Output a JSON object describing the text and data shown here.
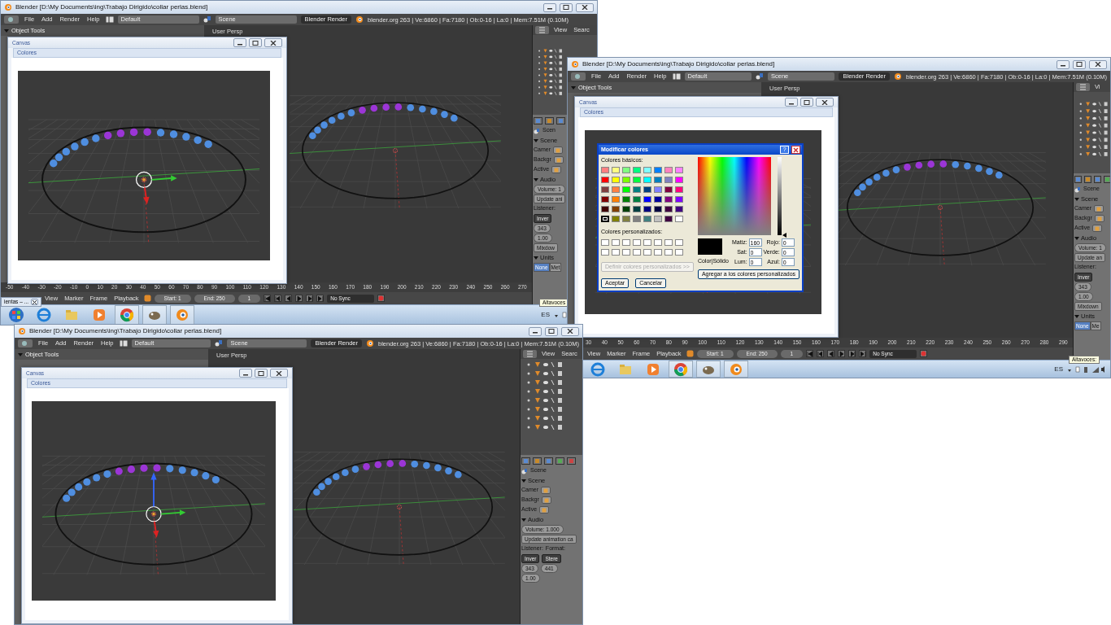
{
  "windows": [
    {
      "title": "Blender [D:\\My Documents\\ing\\Trabajo Dirigido\\collar perlas.blend]",
      "menus": [
        "File",
        "Add",
        "Render",
        "Help"
      ],
      "layout": "Default",
      "scene": "Scene",
      "engine": "Blender Render",
      "info": "blender.org 263 | Ve:6860 | Fa:7180 | Ob:0-16 | La:0 | Mem:7.51M (0.10M)",
      "tools_header": "Object Tools",
      "viewport_label": "User Persp",
      "outliner_menus": [
        "View",
        "Searc"
      ],
      "canvas": {
        "title": "Canvas",
        "menu": "Colores"
      },
      "properties": [
        {
          "cells": [
            {
              "kind": "tabs"
            }
          ]
        },
        {
          "cells": [
            {
              "kind": "breadcrumb",
              "text": "Scen"
            }
          ]
        },
        {
          "cells": [
            {
              "kind": "section",
              "text": "Scene"
            }
          ]
        },
        {
          "cells": [
            {
              "kind": "field",
              "text": "Camer"
            }
          ]
        },
        {
          "cells": [
            {
              "kind": "field",
              "text": "Backgr"
            }
          ]
        },
        {
          "cells": [
            {
              "kind": "field",
              "text": "Active"
            }
          ]
        },
        {
          "cells": [
            {
              "kind": "section",
              "text": "Audio"
            }
          ]
        },
        {
          "cells": [
            {
              "kind": "pill",
              "text": "Volume: 1"
            }
          ]
        },
        {
          "cells": [
            {
              "kind": "button",
              "text": "Update ani"
            }
          ]
        },
        {
          "cells": [
            {
              "kind": "label",
              "text": "Listener:"
            }
          ]
        },
        {
          "cells": [
            {
              "kind": "dropdown",
              "text": "Inver"
            }
          ]
        },
        {
          "cells": [
            {
              "kind": "pill",
              "text": "343"
            }
          ]
        },
        {
          "cells": [
            {
              "kind": "pill",
              "text": "1.00"
            }
          ]
        },
        {
          "cells": [
            {
              "kind": "button",
              "text": "Mixdow"
            }
          ]
        },
        {
          "cells": [
            {
              "kind": "section",
              "text": "Units"
            }
          ]
        },
        {
          "cells": [
            {
              "kind": "toggle",
              "text": "None",
              "selected": true
            },
            {
              "kind": "toggle",
              "text": "Met",
              "selected": false
            }
          ]
        }
      ],
      "timeline": {
        "ruler": [
          "-50",
          "-40",
          "-30",
          "-20",
          "-10",
          "0",
          "10",
          "20",
          "30",
          "40",
          "50",
          "60",
          "70",
          "80",
          "90",
          "100",
          "110",
          "120",
          "130",
          "140",
          "150",
          "160",
          "170",
          "180",
          "190",
          "200",
          "210",
          "220",
          "230",
          "240",
          "250",
          "260",
          "270"
        ],
        "menus": [
          "View",
          "Marker",
          "Frame",
          "Playback"
        ],
        "start": "Start: 1",
        "end": "End: 250",
        "frame": "1",
        "sync": "No Sync"
      },
      "taskbar": {
        "language": "ES"
      },
      "floating_tab": "ientas – ...",
      "tooltip": "Altavoces"
    },
    {
      "title": "Blender [D:\\My Documents\\ing\\Trabajo Dirigido\\collar perlas.blend]",
      "menus": [
        "File",
        "Add",
        "Render",
        "Help"
      ],
      "layout": "Default",
      "scene": "Scene",
      "engine": "Blender Render",
      "info": "blender.org 263 | Ve:6860 | Fa:7180 | Ob:0-16 | La:0 | Mem:7.51M (0.10M)",
      "tools_header": "Object Tools",
      "viewport_label": "User Persp",
      "outliner_menus": [
        "Vi"
      ],
      "canvas": {
        "title": "Canvas",
        "menu": "Colores"
      },
      "properties": [
        {
          "cells": [
            {
              "kind": "tabs"
            }
          ]
        },
        {
          "cells": [
            {
              "kind": "breadcrumb",
              "text": "Scene"
            }
          ]
        },
        {
          "cells": [
            {
              "kind": "section",
              "text": "Scene"
            }
          ]
        },
        {
          "cells": [
            {
              "kind": "field",
              "text": "Camer"
            }
          ]
        },
        {
          "cells": [
            {
              "kind": "field",
              "text": "Backgr"
            }
          ]
        },
        {
          "cells": [
            {
              "kind": "field",
              "text": "Active"
            }
          ]
        },
        {
          "cells": [
            {
              "kind": "section",
              "text": "Audio"
            }
          ]
        },
        {
          "cells": [
            {
              "kind": "pill",
              "text": "Volume: 1"
            }
          ]
        },
        {
          "cells": [
            {
              "kind": "button",
              "text": "Update an"
            }
          ]
        },
        {
          "cells": [
            {
              "kind": "label",
              "text": "Listener:"
            }
          ]
        },
        {
          "cells": [
            {
              "kind": "dropdown",
              "text": "Inver"
            }
          ]
        },
        {
          "cells": [
            {
              "kind": "pill",
              "text": "343"
            }
          ]
        },
        {
          "cells": [
            {
              "kind": "pill",
              "text": "1.00"
            }
          ]
        },
        {
          "cells": [
            {
              "kind": "button",
              "text": "Mixdown"
            }
          ]
        },
        {
          "cells": [
            {
              "kind": "section",
              "text": "Units"
            }
          ]
        },
        {
          "cells": [
            {
              "kind": "toggle",
              "text": "None",
              "selected": true
            },
            {
              "kind": "toggle",
              "text": "Me",
              "selected": false
            }
          ]
        }
      ],
      "timeline": {
        "ruler": [
          "30",
          "40",
          "50",
          "60",
          "70",
          "80",
          "90",
          "100",
          "110",
          "120",
          "130",
          "140",
          "150",
          "160",
          "170",
          "180",
          "190",
          "200",
          "210",
          "220",
          "230",
          "240",
          "250",
          "260",
          "270",
          "280",
          "290"
        ],
        "menus": [
          "View",
          "Marker",
          "Frame",
          "Playback"
        ],
        "start": "Start: 1",
        "end": "End: 250",
        "frame": "1",
        "sync": "No Sync"
      },
      "taskbar": {
        "language": "ES"
      },
      "tooltip": "Altavoces:",
      "color_dialog": {
        "title": "Modificar colores",
        "help": "?",
        "basic_label": "Colores básicos:",
        "basic_colors": [
          {
            "color": "#ff8080",
            "selected": false
          },
          {
            "color": "#ffff80",
            "selected": false
          },
          {
            "color": "#80ff80",
            "selected": false
          },
          {
            "color": "#00ff80",
            "selected": false
          },
          {
            "color": "#80ffff",
            "selected": false
          },
          {
            "color": "#0080ff",
            "selected": false
          },
          {
            "color": "#ff80c0",
            "selected": false
          },
          {
            "color": "#ff80ff",
            "selected": false
          },
          {
            "color": "#ff0000",
            "selected": false
          },
          {
            "color": "#ffff00",
            "selected": false
          },
          {
            "color": "#80ff00",
            "selected": false
          },
          {
            "color": "#00ff40",
            "selected": false
          },
          {
            "color": "#00ffff",
            "selected": false
          },
          {
            "color": "#0080c0",
            "selected": false
          },
          {
            "color": "#8080c0",
            "selected": false
          },
          {
            "color": "#ff00ff",
            "selected": false
          },
          {
            "color": "#804040",
            "selected": false
          },
          {
            "color": "#ff8040",
            "selected": false
          },
          {
            "color": "#00ff00",
            "selected": false
          },
          {
            "color": "#008080",
            "selected": false
          },
          {
            "color": "#004080",
            "selected": false
          },
          {
            "color": "#8080ff",
            "selected": false
          },
          {
            "color": "#800040",
            "selected": false
          },
          {
            "color": "#ff0080",
            "selected": false
          },
          {
            "color": "#800000",
            "selected": false
          },
          {
            "color": "#ff8000",
            "selected": false
          },
          {
            "color": "#008000",
            "selected": false
          },
          {
            "color": "#008040",
            "selected": false
          },
          {
            "color": "#0000ff",
            "selected": false
          },
          {
            "color": "#0000a0",
            "selected": false
          },
          {
            "color": "#800080",
            "selected": false
          },
          {
            "color": "#8000ff",
            "selected": false
          },
          {
            "color": "#400000",
            "selected": false
          },
          {
            "color": "#804000",
            "selected": false
          },
          {
            "color": "#004000",
            "selected": false
          },
          {
            "color": "#004040",
            "selected": false
          },
          {
            "color": "#000080",
            "selected": false
          },
          {
            "color": "#000040",
            "selected": false
          },
          {
            "color": "#400040",
            "selected": false
          },
          {
            "color": "#400080",
            "selected": false
          },
          {
            "color": "#000000",
            "selected": true
          },
          {
            "color": "#808000",
            "selected": false
          },
          {
            "color": "#808040",
            "selected": false
          },
          {
            "color": "#808080",
            "selected": false
          },
          {
            "color": "#408080",
            "selected": false
          },
          {
            "color": "#c0c0c0",
            "selected": false
          },
          {
            "color": "#400041",
            "selected": false
          },
          {
            "color": "#ffffff",
            "selected": false
          }
        ],
        "custom_label": "Colores personalizados:",
        "define": {
          "label": "Definir colores personalizados >>",
          "disabled": true
        },
        "ok": "Aceptar",
        "cancel": "Cancelar",
        "solid_label": "Color|Sólido",
        "fields": [
          {
            "label": "Matiz:",
            "value": "160"
          },
          {
            "label": "Rojo:",
            "value": "0"
          },
          {
            "label": "Sat:",
            "value": "0"
          },
          {
            "label": "Verde:",
            "value": "0"
          },
          {
            "label": "Lum:",
            "value": "0"
          },
          {
            "label": "Azul:",
            "value": "0"
          }
        ],
        "add": "Agregar a los colores personalizados",
        "luminance": {
          "level": 0
        }
      }
    },
    {
      "title": "Blender [D:\\My Documents\\ing\\Trabajo Dirigido\\collar perlas.blend]",
      "menus": [
        "File",
        "Add",
        "Render",
        "Help"
      ],
      "layout": "Default",
      "scene": "Scene",
      "engine": "Blender Render",
      "info": "blender.org 263 | Ve:6860 | Fa:7180 | Ob:0-16 | La:0 | Mem:7.51M (0.10M)",
      "tools_header": "Object Tools",
      "viewport_label": "User Persp",
      "outliner_menus": [
        "View",
        "Searc"
      ],
      "canvas": {
        "title": "Canvas",
        "menu": "Colores"
      },
      "properties": [
        {
          "cells": [
            {
              "kind": "tabs"
            }
          ]
        },
        {
          "cells": [
            {
              "kind": "breadcrumb",
              "text": "Scene"
            }
          ]
        },
        {
          "cells": [
            {
              "kind": "section",
              "text": "Scene"
            }
          ]
        },
        {
          "cells": [
            {
              "kind": "field",
              "text": "Camer"
            }
          ]
        },
        {
          "cells": [
            {
              "kind": "field",
              "text": "Backgr"
            }
          ]
        },
        {
          "cells": [
            {
              "kind": "field",
              "text": "Active"
            }
          ]
        },
        {
          "cells": [
            {
              "kind": "section",
              "text": "Audio"
            }
          ]
        },
        {
          "cells": [
            {
              "kind": "pill",
              "text": "Volume: 1.000"
            }
          ]
        },
        {
          "cells": [
            {
              "kind": "button",
              "text": "Update animation ca"
            }
          ]
        },
        {
          "cells": [
            {
              "kind": "label",
              "text": "Listener:"
            },
            {
              "kind": "label",
              "text": "Format:"
            }
          ]
        },
        {
          "cells": [
            {
              "kind": "dropdown",
              "text": "Inver"
            },
            {
              "kind": "dropdown",
              "text": "Stere"
            }
          ]
        },
        {
          "cells": [
            {
              "kind": "pill",
              "text": "343"
            },
            {
              "kind": "pill",
              "text": "441"
            }
          ]
        },
        {
          "cells": [
            {
              "kind": "pill",
              "text": "1.00"
            }
          ]
        }
      ]
    }
  ]
}
